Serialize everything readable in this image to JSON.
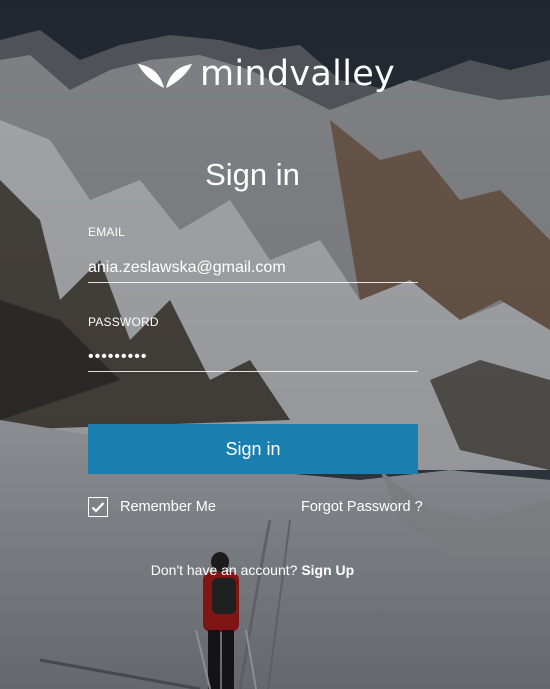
{
  "brand": {
    "name": "mindvalley"
  },
  "form": {
    "title": "Sign in",
    "email_label": "EMAIL",
    "email_value": "ania.zeslawska@gmail.com",
    "password_label": "PASSWORD",
    "password_value": "•••••••••",
    "submit_label": "Sign in",
    "remember_label": "Remember Me",
    "remember_checked": true,
    "forgot_label": "Forgot Password ?"
  },
  "footer": {
    "prompt": "Don't have an account?",
    "signup_label": "Sign Up"
  },
  "colors": {
    "button": "#1a7fae",
    "text": "#ffffff"
  },
  "background": {
    "scene": "snowy mountain range with hiker in red jacket"
  }
}
